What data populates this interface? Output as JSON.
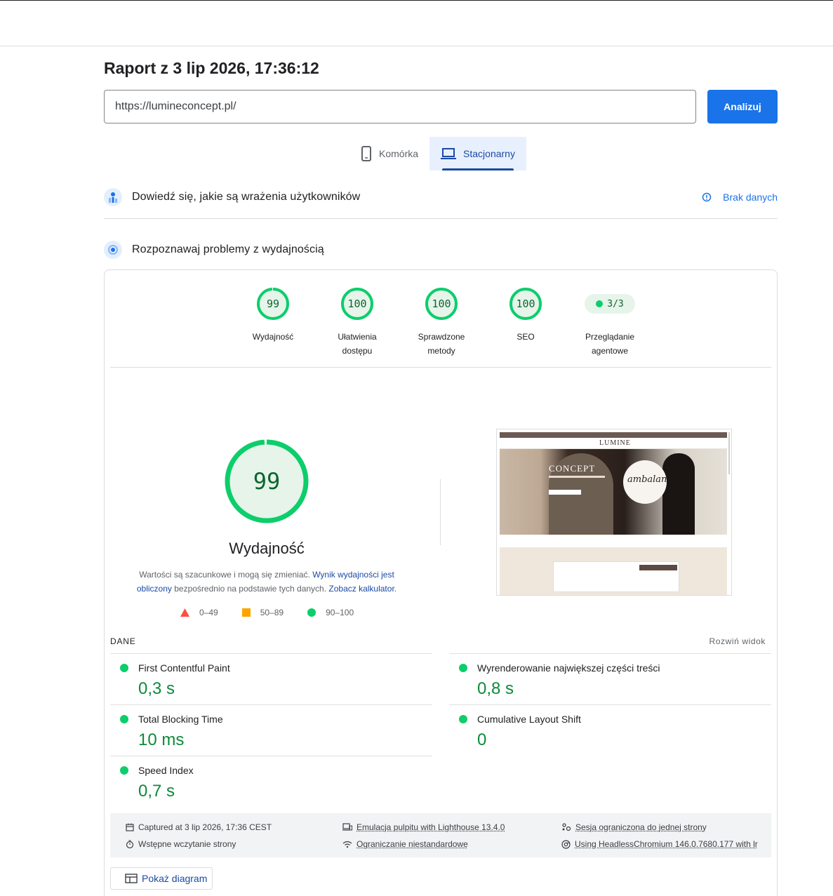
{
  "report": {
    "title": "Raport z 3 lip 2026, 17:36:12",
    "url_value": "https://lumineconcept.pl/",
    "analyze_label": "Analizuj"
  },
  "tabs": [
    {
      "label": "Komórka",
      "icon": "phone-icon",
      "active": false
    },
    {
      "label": "Stacjonarny",
      "icon": "laptop-icon",
      "active": true
    }
  ],
  "field_data": {
    "title": "Dowiedź się, jakie są wrażenia użytkowników",
    "status": "Brak danych"
  },
  "lab": {
    "title": "Rozpoznawaj problemy z wydajnością"
  },
  "categories": [
    {
      "score": "99",
      "label1": "Wydajność",
      "label2": "",
      "fraction": 0.99
    },
    {
      "score": "100",
      "label1": "Ułatwienia",
      "label2": "dostępu",
      "fraction": 1.0
    },
    {
      "score": "100",
      "label1": "Sprawdzone",
      "label2": "metody",
      "fraction": 1.0
    },
    {
      "score": "100",
      "label1": "SEO",
      "label2": "",
      "fraction": 1.0
    },
    {
      "score": "3/3",
      "label1": "Przeglądanie",
      "label2": "agentowe"
    }
  ],
  "performance": {
    "score": "99",
    "fraction": 0.99,
    "title": "Wydajność",
    "desc_part1": "Wartości są szacunkowe i mogą się zmieniać. ",
    "desc_link1": "Wynik wydajności jest obliczony",
    "desc_part2": " bezpośrednio na podstawie tych danych. ",
    "desc_link2": "Zobacz kalkulator",
    "desc_part3": ".",
    "legend": [
      "0–49",
      "50–89",
      "90–100"
    ]
  },
  "screenshot": {
    "brand": "LUMINE",
    "hero_text": "CONCEPT",
    "logo_text": "ambalan"
  },
  "metrics": {
    "section_label": "DANE",
    "expand_label": "Rozwiń widok",
    "items": [
      {
        "name": "First Contentful Paint",
        "value": "0,3 s"
      },
      {
        "name": "Wyrenderowanie największej części treści",
        "value": "0,8 s"
      },
      {
        "name": "Total Blocking Time",
        "value": "10 ms"
      },
      {
        "name": "Cumulative Layout Shift",
        "value": "0"
      },
      {
        "name": "Speed Index",
        "value": "0,7 s"
      }
    ]
  },
  "run_info": {
    "captured": "Captured at 3 lip 2026, 17:36 CEST",
    "initial_load": "Wstępne wczytanie strony",
    "emulation": "Emulacja pulpitu with Lighthouse 13.4.0",
    "throttling": "Ograniczanie niestandardowe",
    "session": "Sesja ograniczona do jednej strony",
    "browser": "Using HeadlessChromium 146.0.7680.177 with lr"
  },
  "diagram_label": "Pokaż diagram",
  "colors": {
    "accent": "#1a73e8",
    "pass": "#0cce6b",
    "pass_text": "#0d652d",
    "average": "#ffa400",
    "fail": "#ff4e42"
  }
}
